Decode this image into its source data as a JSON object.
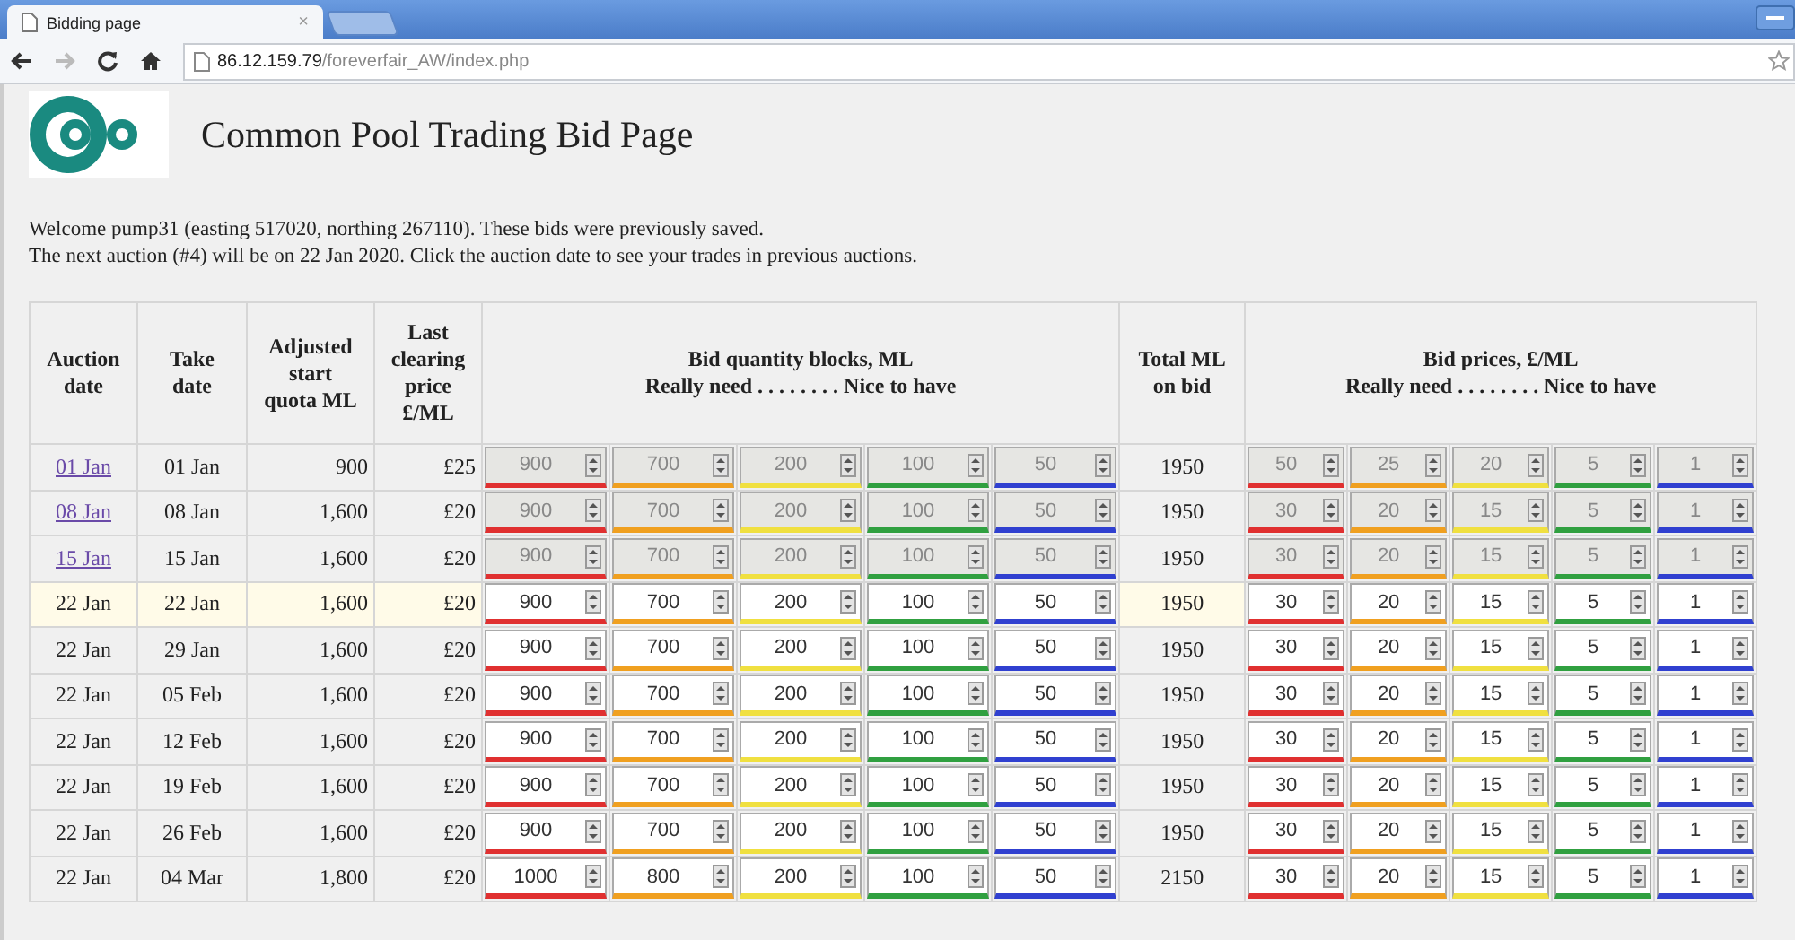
{
  "browser": {
    "tab": {
      "title": "Bidding page",
      "close": "×"
    },
    "url_host": "86.12.159.79",
    "url_path": "/foreverfair_AW/index.php"
  },
  "page": {
    "title": "Common Pool Trading Bid Page",
    "welcome": "Welcome pump31 (easting 517020, northing 267110). These bids were previously saved.",
    "next_auction": "The next auction (#4) will be on 22 Jan 2020. Click the auction date to see your trades in previous auctions."
  },
  "table": {
    "columns": [
      [
        "Auction",
        "date"
      ],
      [
        "Take",
        "date"
      ],
      [
        "Adjusted",
        "start",
        "quota ML"
      ],
      [
        "Last",
        "clearing",
        "price",
        "£/ML"
      ]
    ],
    "quantity_header": [
      "Bid quantity blocks, ML",
      "Really need  . . . . . . . . Nice to have"
    ],
    "total_header": [
      "Total ML",
      "on bid"
    ],
    "price_header": [
      "Bid prices, £/ML",
      "Really need  . . . . . . . . Nice to have"
    ],
    "blocks": [
      {
        "color": "#e03030"
      },
      {
        "color": "#f0a020"
      },
      {
        "color": "#f0e040"
      },
      {
        "color": "#30a040"
      },
      {
        "color": "#3040d0"
      }
    ],
    "rows": [
      {
        "auction_date": "01 Jan",
        "link": true,
        "locked": true,
        "selected": false,
        "take_date": "01 Jan",
        "quota": "900",
        "price": "£25",
        "quantities": [
          "900",
          "700",
          "200",
          "100",
          "50"
        ],
        "total": "1950",
        "prices": [
          "50",
          "25",
          "20",
          "5",
          "1"
        ]
      },
      {
        "auction_date": "08 Jan",
        "link": true,
        "locked": true,
        "selected": false,
        "take_date": "08 Jan",
        "quota": "1,600",
        "price": "£20",
        "quantities": [
          "900",
          "700",
          "200",
          "100",
          "50"
        ],
        "total": "1950",
        "prices": [
          "30",
          "20",
          "15",
          "5",
          "1"
        ]
      },
      {
        "auction_date": "15 Jan",
        "link": true,
        "locked": true,
        "selected": false,
        "take_date": "15 Jan",
        "quota": "1,600",
        "price": "£20",
        "quantities": [
          "900",
          "700",
          "200",
          "100",
          "50"
        ],
        "total": "1950",
        "prices": [
          "30",
          "20",
          "15",
          "5",
          "1"
        ]
      },
      {
        "auction_date": "22 Jan",
        "link": false,
        "locked": false,
        "selected": true,
        "take_date": "22 Jan",
        "quota": "1,600",
        "price": "£20",
        "quantities": [
          "900",
          "700",
          "200",
          "100",
          "50"
        ],
        "total": "1950",
        "prices": [
          "30",
          "20",
          "15",
          "5",
          "1"
        ]
      },
      {
        "auction_date": "22 Jan",
        "link": false,
        "locked": false,
        "selected": false,
        "take_date": "29 Jan",
        "quota": "1,600",
        "price": "£20",
        "quantities": [
          "900",
          "700",
          "200",
          "100",
          "50"
        ],
        "total": "1950",
        "prices": [
          "30",
          "20",
          "15",
          "5",
          "1"
        ]
      },
      {
        "auction_date": "22 Jan",
        "link": false,
        "locked": false,
        "selected": false,
        "take_date": "05 Feb",
        "quota": "1,600",
        "price": "£20",
        "quantities": [
          "900",
          "700",
          "200",
          "100",
          "50"
        ],
        "total": "1950",
        "prices": [
          "30",
          "20",
          "15",
          "5",
          "1"
        ]
      },
      {
        "auction_date": "22 Jan",
        "link": false,
        "locked": false,
        "selected": false,
        "take_date": "12 Feb",
        "quota": "1,600",
        "price": "£20",
        "quantities": [
          "900",
          "700",
          "200",
          "100",
          "50"
        ],
        "total": "1950",
        "prices": [
          "30",
          "20",
          "15",
          "5",
          "1"
        ]
      },
      {
        "auction_date": "22 Jan",
        "link": false,
        "locked": false,
        "selected": false,
        "take_date": "19 Feb",
        "quota": "1,600",
        "price": "£20",
        "quantities": [
          "900",
          "700",
          "200",
          "100",
          "50"
        ],
        "total": "1950",
        "prices": [
          "30",
          "20",
          "15",
          "5",
          "1"
        ]
      },
      {
        "auction_date": "22 Jan",
        "link": false,
        "locked": false,
        "selected": false,
        "take_date": "26 Feb",
        "quota": "1,600",
        "price": "£20",
        "quantities": [
          "900",
          "700",
          "200",
          "100",
          "50"
        ],
        "total": "1950",
        "prices": [
          "30",
          "20",
          "15",
          "5",
          "1"
        ]
      },
      {
        "auction_date": "22 Jan",
        "link": false,
        "locked": false,
        "selected": false,
        "take_date": "04 Mar",
        "quota": "1,800",
        "price": "£20",
        "quantities": [
          "1000",
          "800",
          "200",
          "100",
          "50"
        ],
        "total": "2150",
        "prices": [
          "30",
          "20",
          "15",
          "5",
          "1"
        ]
      }
    ]
  }
}
